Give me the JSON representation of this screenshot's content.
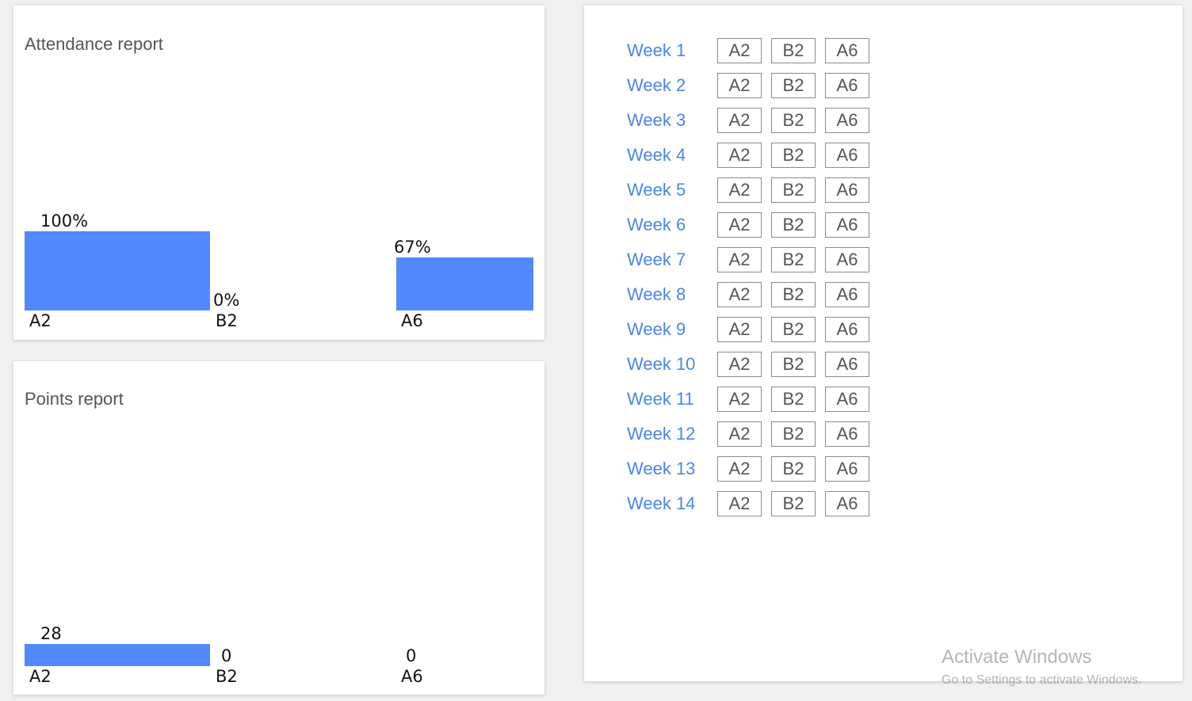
{
  "attendance": {
    "title": "Attendance report",
    "chart_data": {
      "type": "bar",
      "categories": [
        "A2",
        "B2",
        "A6"
      ],
      "values": [
        100,
        0,
        67
      ],
      "value_labels": [
        "100%",
        "0%",
        "67%"
      ],
      "ylim": [
        0,
        100
      ],
      "bar_color": "#5289fd"
    }
  },
  "points": {
    "title": "Points report",
    "chart_data": {
      "type": "bar",
      "categories": [
        "A2",
        "B2",
        "A6"
      ],
      "values": [
        28,
        0,
        0
      ],
      "value_labels": [
        "28",
        "0",
        "0"
      ],
      "ylim": [
        0,
        100
      ],
      "bar_color": "#5289fd"
    }
  },
  "weeks": [
    {
      "label": "Week 1",
      "buttons": [
        "A2",
        "B2",
        "A6"
      ]
    },
    {
      "label": "Week 2",
      "buttons": [
        "A2",
        "B2",
        "A6"
      ]
    },
    {
      "label": "Week 3",
      "buttons": [
        "A2",
        "B2",
        "A6"
      ]
    },
    {
      "label": "Week 4",
      "buttons": [
        "A2",
        "B2",
        "A6"
      ]
    },
    {
      "label": "Week 5",
      "buttons": [
        "A2",
        "B2",
        "A6"
      ]
    },
    {
      "label": "Week 6",
      "buttons": [
        "A2",
        "B2",
        "A6"
      ]
    },
    {
      "label": "Week 7",
      "buttons": [
        "A2",
        "B2",
        "A6"
      ]
    },
    {
      "label": "Week 8",
      "buttons": [
        "A2",
        "B2",
        "A6"
      ]
    },
    {
      "label": "Week 9",
      "buttons": [
        "A2",
        "B2",
        "A6"
      ]
    },
    {
      "label": "Week 10",
      "buttons": [
        "A2",
        "B2",
        "A6"
      ]
    },
    {
      "label": "Week 11",
      "buttons": [
        "A2",
        "B2",
        "A6"
      ]
    },
    {
      "label": "Week 12",
      "buttons": [
        "A2",
        "B2",
        "A6"
      ]
    },
    {
      "label": "Week 13",
      "buttons": [
        "A2",
        "B2",
        "A6"
      ]
    },
    {
      "label": "Week 14",
      "buttons": [
        "A2",
        "B2",
        "A6"
      ]
    }
  ],
  "watermark": {
    "title": "Activate Windows",
    "subtitle": "Go to Settings to activate Windows."
  }
}
